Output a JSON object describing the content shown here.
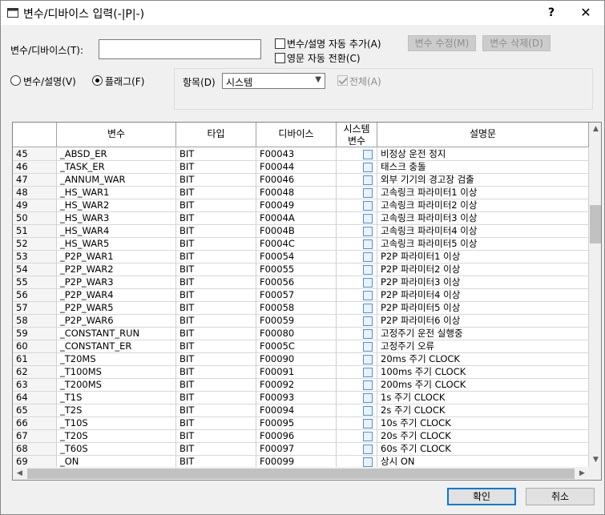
{
  "window": {
    "title": "변수/디바이스 입력(-|P|-)",
    "help_label": "?",
    "close_label": "✕"
  },
  "form": {
    "var_device_label": "변수/디바이스(T):",
    "var_device_value": "",
    "auto_add_label": "변수/설명 자동 추가(A)",
    "auto_add_checked": false,
    "eng_convert_label": "영문 자동 전환(C)",
    "eng_convert_checked": false,
    "modify_button": "변수 수정(M)",
    "delete_button": "변수 삭제(D)",
    "radio_var_label": "변수/설명(V)",
    "radio_flag_label": "플래그(F)",
    "selected_radio": "flag",
    "item_label": "항목(D)",
    "item_selected": "시스템",
    "all_label": "전체(A)",
    "all_checked": true
  },
  "table": {
    "columns": [
      "",
      "변수",
      "타입",
      "디바이스",
      "시스템\n변수",
      "설명문"
    ],
    "column_sys_line1": "시스템",
    "column_sys_line2": "변수",
    "rows": [
      {
        "no": "45",
        "var": "_ABSD_ER",
        "type": "BIT",
        "device": "F00043",
        "desc": "비정상 운전 정지"
      },
      {
        "no": "46",
        "var": "_TASK_ER",
        "type": "BIT",
        "device": "F00044",
        "desc": "태스크 충돌"
      },
      {
        "no": "47",
        "var": "_ANNUM_WAR",
        "type": "BIT",
        "device": "F00046",
        "desc": "외부 기기의 경고장 검출"
      },
      {
        "no": "48",
        "var": "_HS_WAR1",
        "type": "BIT",
        "device": "F00048",
        "desc": "고속링크 파라미터1 이상"
      },
      {
        "no": "49",
        "var": "_HS_WAR2",
        "type": "BIT",
        "device": "F00049",
        "desc": "고속링크 파라미터2 이상"
      },
      {
        "no": "50",
        "var": "_HS_WAR3",
        "type": "BIT",
        "device": "F0004A",
        "desc": "고속링크 파라미터3 이상"
      },
      {
        "no": "51",
        "var": "_HS_WAR4",
        "type": "BIT",
        "device": "F0004B",
        "desc": "고속링크 파라미터4 이상"
      },
      {
        "no": "52",
        "var": "_HS_WAR5",
        "type": "BIT",
        "device": "F0004C",
        "desc": "고속링크 파라미터5 이상"
      },
      {
        "no": "53",
        "var": "_P2P_WAR1",
        "type": "BIT",
        "device": "F00054",
        "desc": "P2P 파라미터1 이상"
      },
      {
        "no": "54",
        "var": "_P2P_WAR2",
        "type": "BIT",
        "device": "F00055",
        "desc": "P2P 파라미터2 이상"
      },
      {
        "no": "55",
        "var": "_P2P_WAR3",
        "type": "BIT",
        "device": "F00056",
        "desc": "P2P 파라미터3 이상"
      },
      {
        "no": "56",
        "var": "_P2P_WAR4",
        "type": "BIT",
        "device": "F00057",
        "desc": "P2P 파라미터4 이상"
      },
      {
        "no": "57",
        "var": "_P2P_WAR5",
        "type": "BIT",
        "device": "F00058",
        "desc": "P2P 파라미터5 이상"
      },
      {
        "no": "58",
        "var": "_P2P_WAR6",
        "type": "BIT",
        "device": "F00059",
        "desc": "P2P 파라미터6 이상"
      },
      {
        "no": "59",
        "var": "_CONSTANT_RUN",
        "type": "BIT",
        "device": "F00080",
        "desc": "고정주기 운전 실행중"
      },
      {
        "no": "60",
        "var": "_CONSTANT_ER",
        "type": "BIT",
        "device": "F0005C",
        "desc": "고정주기 오류"
      },
      {
        "no": "61",
        "var": "_T20MS",
        "type": "BIT",
        "device": "F00090",
        "desc": "20ms 주기 CLOCK"
      },
      {
        "no": "62",
        "var": "_T100MS",
        "type": "BIT",
        "device": "F00091",
        "desc": "100ms 주기 CLOCK"
      },
      {
        "no": "63",
        "var": "_T200MS",
        "type": "BIT",
        "device": "F00092",
        "desc": "200ms 주기 CLOCK"
      },
      {
        "no": "64",
        "var": "_T1S",
        "type": "BIT",
        "device": "F00093",
        "desc": "1s 주기 CLOCK"
      },
      {
        "no": "65",
        "var": "_T2S",
        "type": "BIT",
        "device": "F00094",
        "desc": "2s 주기 CLOCK"
      },
      {
        "no": "66",
        "var": "_T10S",
        "type": "BIT",
        "device": "F00095",
        "desc": "10s 주기 CLOCK"
      },
      {
        "no": "67",
        "var": "_T20S",
        "type": "BIT",
        "device": "F00096",
        "desc": "20s 주기 CLOCK"
      },
      {
        "no": "68",
        "var": "_T60S",
        "type": "BIT",
        "device": "F00097",
        "desc": "60s 주기 CLOCK"
      },
      {
        "no": "69",
        "var": "_ON",
        "type": "BIT",
        "device": "F00099",
        "desc": "상시 ON"
      }
    ]
  },
  "footer": {
    "ok_label": "확인",
    "cancel_label": "취소"
  },
  "colors": {
    "accent": "#0078d7",
    "checkbox_border": "#4a90d9"
  }
}
